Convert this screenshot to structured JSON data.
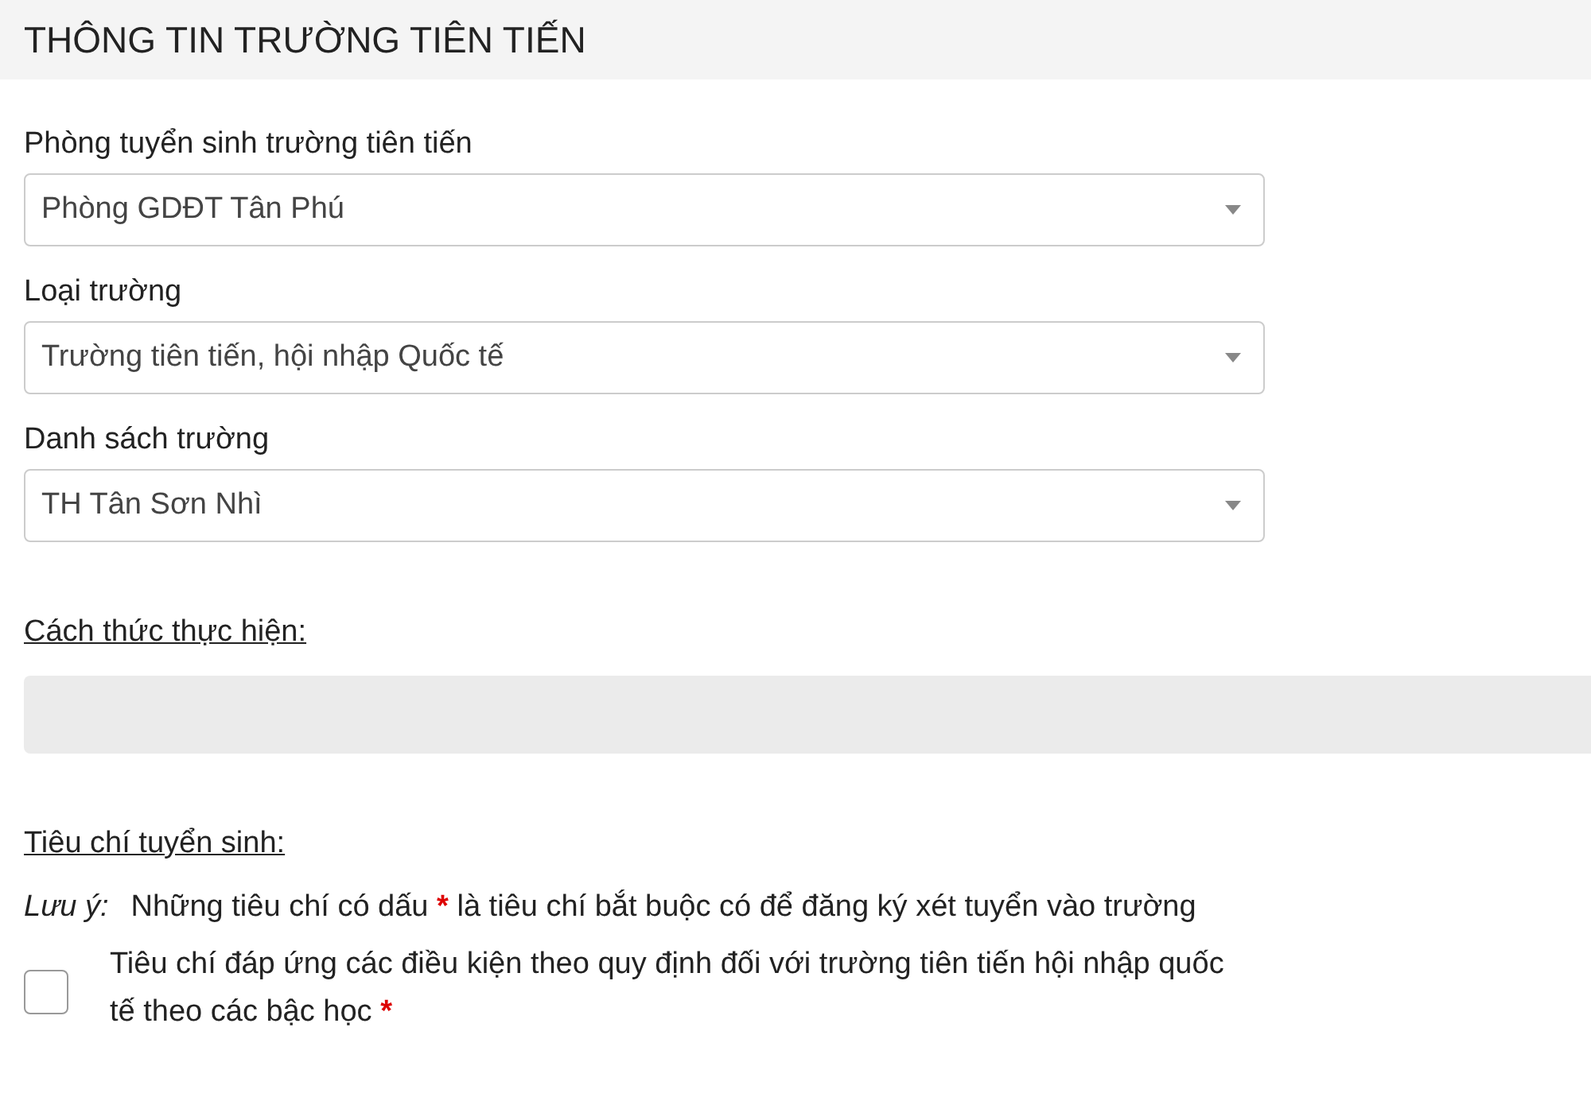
{
  "section": {
    "title": "THÔNG TIN TRƯỜNG TIÊN TIẾN"
  },
  "fields": [
    {
      "label": "Phòng tuyển sinh trường tiên tiến",
      "value": "Phòng GDĐT Tân Phú"
    },
    {
      "label": "Loại trường",
      "value": "Trường tiên tiến, hội nhập Quốc tế"
    },
    {
      "label": "Danh sách trường",
      "value": "TH Tân Sơn Nhì"
    }
  ],
  "method": {
    "heading": "Cách thức thực hiện:"
  },
  "criteria": {
    "heading": "Tiêu chí tuyển sinh:",
    "note": {
      "label": "Lưu ý:",
      "text_before": "Những tiêu chí có dấu",
      "required_mark": "*",
      "text_after": "là tiêu chí bắt buộc có để đăng ký xét tuyển vào trường"
    },
    "items": [
      {
        "label": "Tiêu chí đáp ứng các điều kiện theo quy định đối với trường tiên tiến hội nhập quốc tế theo các bậc học",
        "required_mark": "*",
        "checked": false
      }
    ]
  }
}
